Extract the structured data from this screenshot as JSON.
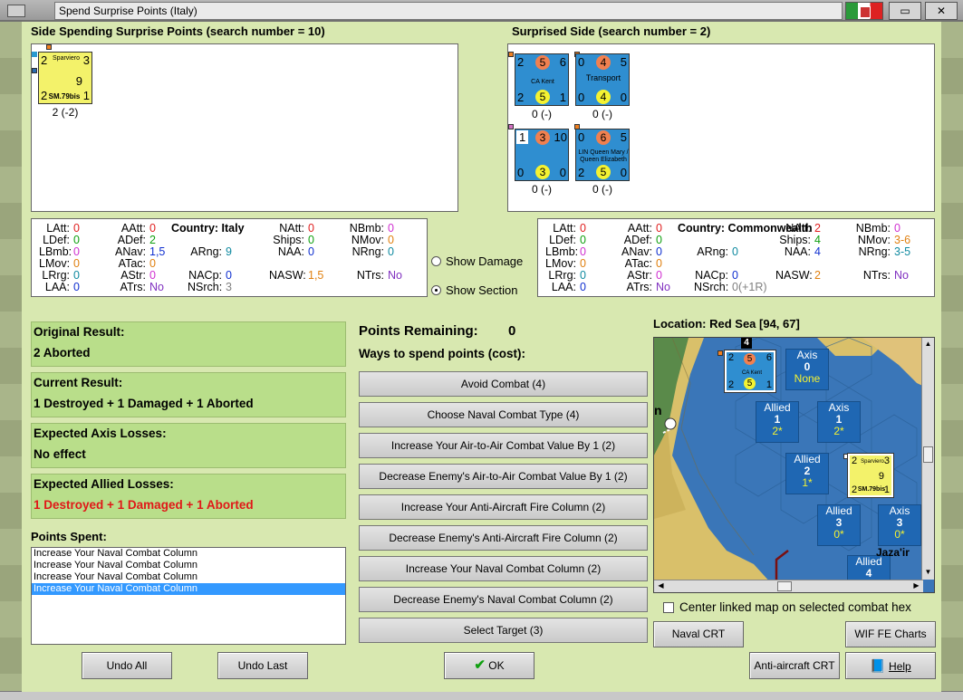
{
  "window": {
    "title": "Spend Surprise Points (Italy)",
    "restore_label": "▭",
    "close_label": "✕"
  },
  "left_panel": {
    "title": "Side Spending Surprise Points (search number = 10)",
    "counters": [
      {
        "name": "Sparviero",
        "top_left": "2",
        "top_right": "3",
        "bottom_left": "2",
        "bottom_right": "1",
        "mid": "9",
        "type": "SM.79bis",
        "caption": "2 (-2)"
      }
    ]
  },
  "right_panel": {
    "title": "Surprised Side (search number = 2)",
    "counters": [
      {
        "name": "CA Kent",
        "tl": "2",
        "tc": "5",
        "tr": "6",
        "bl": "2",
        "bc": "5",
        "br": "1",
        "caption": "0 (-)"
      },
      {
        "name": "Transport",
        "tl": "0",
        "tc": "4",
        "tr": "5",
        "bl": "0",
        "bc": "4",
        "br": "0",
        "caption": "0 (-)"
      },
      {
        "name": "",
        "tl": "1",
        "tc": "3",
        "tr": "10",
        "bl": "0",
        "bc": "3",
        "br": "0",
        "caption": "0 (-)"
      },
      {
        "name": "LIN Queen Mary / Queen Elizabeth",
        "tl": "0",
        "tc": "6",
        "tr": "5",
        "bl": "2",
        "bc": "5",
        "br": "0",
        "caption": "0 (-)"
      }
    ]
  },
  "italy_stats": {
    "country": "Country: Italy",
    "rows": [
      [
        [
          "LAtt:",
          "0",
          "red"
        ],
        [
          "AAtt:",
          "0",
          "red"
        ],
        [
          "NAtt:",
          "0",
          "red"
        ],
        [
          "NBmb:",
          "0",
          "mag"
        ]
      ],
      [
        [
          "LDef:",
          "0",
          "green"
        ],
        [
          "ADef:",
          "2",
          "green"
        ],
        [
          "Ships:",
          "0",
          "green"
        ],
        [
          "NMov:",
          "0",
          "orange"
        ]
      ],
      [
        [
          "LBmb:",
          "0",
          "mag"
        ],
        [
          "ANav:",
          "1,5",
          "blue"
        ],
        [
          "ARng:",
          "9",
          "cyan"
        ],
        [
          "NAA:",
          "0",
          "blue"
        ],
        [
          "NRng:",
          "0",
          "cyan"
        ]
      ],
      [
        [
          "LMov:",
          "0",
          "orange"
        ],
        [
          "ATac:",
          "0",
          "orange"
        ]
      ],
      [
        [
          "LRrg:",
          "0",
          "cyan"
        ],
        [
          "AStr:",
          "0",
          "mag"
        ],
        [
          "NACp:",
          "0",
          "blue"
        ],
        [
          "NASW:",
          "1,5",
          "orange"
        ],
        [
          "NTrs:",
          "No",
          "purple"
        ]
      ],
      [
        [
          "LAA:",
          "0",
          "blue"
        ],
        [
          "ATrs:",
          "No",
          "purple"
        ],
        [
          "NSrch:",
          "3",
          "gray"
        ]
      ]
    ]
  },
  "commonwealth_stats": {
    "country": "Country: Commonwealth",
    "rows": [
      [
        [
          "LAtt:",
          "0",
          "red"
        ],
        [
          "AAtt:",
          "0",
          "red"
        ],
        [
          "NAtt:",
          "2",
          "red"
        ],
        [
          "NBmb:",
          "0",
          "mag"
        ]
      ],
      [
        [
          "LDef:",
          "0",
          "green"
        ],
        [
          "ADef:",
          "0",
          "green"
        ],
        [
          "Ships:",
          "4",
          "green"
        ],
        [
          "NMov:",
          "3-6",
          "orange"
        ]
      ],
      [
        [
          "LBmb:",
          "0",
          "mag"
        ],
        [
          "ANav:",
          "0",
          "blue"
        ],
        [
          "ARng:",
          "0",
          "cyan"
        ],
        [
          "NAA:",
          "4",
          "blue"
        ],
        [
          "NRng:",
          "3-5",
          "cyan"
        ]
      ],
      [
        [
          "LMov:",
          "0",
          "orange"
        ],
        [
          "ATac:",
          "0",
          "orange"
        ]
      ],
      [
        [
          "LRrg:",
          "0",
          "cyan"
        ],
        [
          "AStr:",
          "0",
          "mag"
        ],
        [
          "NACp:",
          "0",
          "blue"
        ],
        [
          "NASW:",
          "2",
          "orange"
        ],
        [
          "NTrs:",
          "No",
          "purple"
        ]
      ],
      [
        [
          "LAA:",
          "0",
          "blue"
        ],
        [
          "ATrs:",
          "No",
          "purple"
        ],
        [
          "NSrch:",
          "0(+1R)",
          "gray"
        ]
      ]
    ]
  },
  "options": {
    "show_damage": "Show Damage",
    "show_section": "Show Section",
    "selected": "show_section"
  },
  "results": {
    "original_title": "Original Result:",
    "original_value": "2 Aborted",
    "current_title": "Current Result:",
    "current_value": "1 Destroyed + 1 Damaged + 1 Aborted",
    "axis_title": "Expected Axis Losses:",
    "axis_value": "No effect",
    "allied_title": "Expected Allied Losses:",
    "allied_value": "1 Destroyed + 1 Damaged + 1 Aborted"
  },
  "points_spent": {
    "title": "Points Spent:",
    "items": [
      "Increase Your Naval Combat Column",
      "Increase Your Naval Combat Column",
      "Increase Your Naval Combat Column",
      "Increase Your Naval Combat Column"
    ],
    "selected_index": 3
  },
  "spend": {
    "remaining_label": "Points Remaining:",
    "remaining_value": "0",
    "ways_label": "Ways to spend points (cost):",
    "options": [
      "Avoid Combat (4)",
      "Choose Naval Combat Type (4)",
      "Increase Your Air-to-Air Combat Value By 1 (2)",
      "Decrease Enemy's Air-to-Air Combat Value By 1 (2)",
      "Increase Your Anti-Aircraft Fire Column (2)",
      "Decrease Enemy's Anti-Aircraft Fire Column (2)",
      "Increase Your Naval Combat Column (2)",
      "Decrease Enemy's Naval Combat Column (2)",
      "Select Target (3)"
    ]
  },
  "map": {
    "location": "Location: Red Sea [94, 67]",
    "hexes": [
      {
        "side": "Axis",
        "num": "0",
        "val": "None"
      },
      {
        "side": "Allied",
        "num": "1",
        "val": "2*"
      },
      {
        "side": "Axis",
        "num": "1",
        "val": "2*"
      },
      {
        "side": "Allied",
        "num": "2",
        "val": "1*"
      },
      {
        "side": "Allied",
        "num": "3",
        "val": "0*"
      },
      {
        "side": "Axis",
        "num": "3",
        "val": "0*"
      },
      {
        "side": "Allied",
        "num": "4",
        "val": ""
      }
    ],
    "place_label": "Jaza'ir",
    "stack_count": "4",
    "n_label": "n",
    "center_linked": "Center linked map on selected combat hex"
  },
  "buttons": {
    "undo_all": "Undo All",
    "undo_last": "Undo Last",
    "ok": "OK",
    "naval_crt": "Naval CRT",
    "wif_fe_charts": "WIF FE Charts",
    "anti_aircraft_crt": "Anti-aircraft CRT",
    "help": "Help"
  }
}
